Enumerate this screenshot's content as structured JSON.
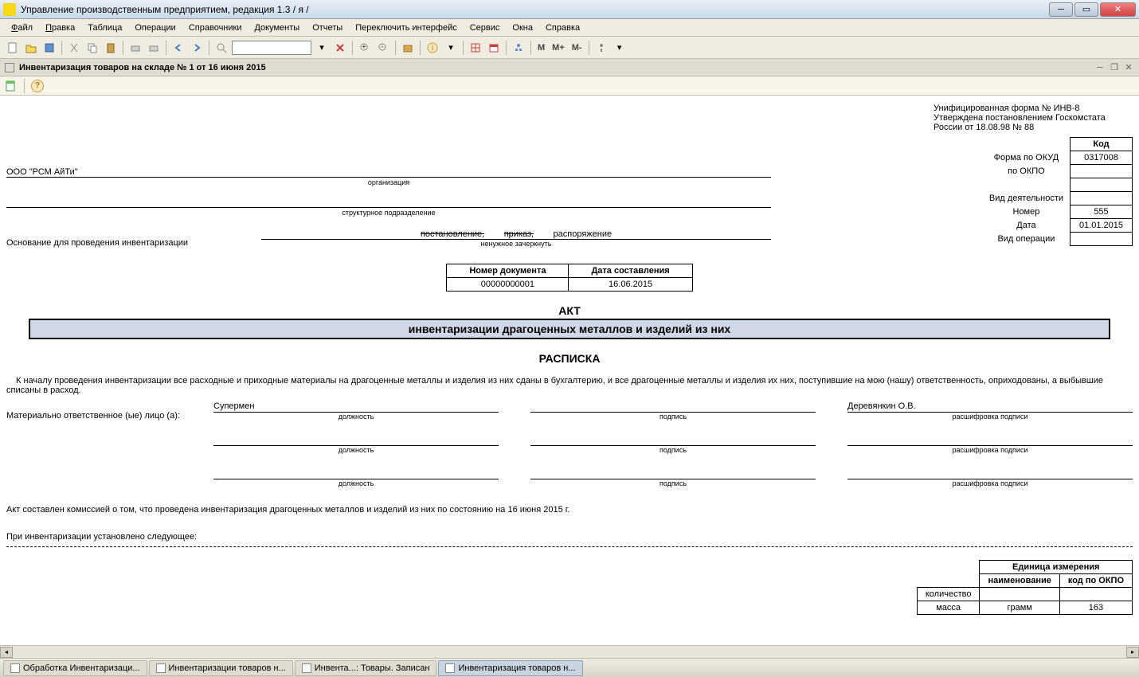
{
  "titlebar": {
    "text": "Управление производственным предприятием, редакция 1.3 / я /"
  },
  "menu": {
    "file": "Файл",
    "edit": "Правка",
    "table": "Таблица",
    "operations": "Операции",
    "directories": "Справочники",
    "documents": "Документы",
    "reports": "Отчеты",
    "switch_interface": "Переключить интерфейс",
    "service": "Сервис",
    "windows": "Окна",
    "help": "Справка"
  },
  "toolbar": {
    "m": "М",
    "mplus": "М+",
    "mminus": "М-"
  },
  "doc_tab": {
    "title": "Инвентаризация товаров на складе № 1 от 16 июня 2015"
  },
  "form": {
    "header_lines": {
      "l1": "Унифицированная форма № ИНВ-8",
      "l2": "Утверждена постановлением Госкомстата",
      "l3": "России от 18.08.98 № 88"
    },
    "code_header": "Код",
    "okud_label": "Форма по ОКУД",
    "okud_val": "0317008",
    "okpo_label": "по ОКПО",
    "activity_label": "Вид деятельности",
    "number_label": "Номер",
    "number_val": "555",
    "date_label": "Дата",
    "date_val": "01.01.2015",
    "operation_label": "Вид операции",
    "org_name": "ООО \"РСМ АйТи\"",
    "org_caption": "организация",
    "subdiv_caption": "структурное подразделение",
    "basis_label": "Основание для проведения инвентаризации",
    "basis_opt1": "постановление,",
    "basis_opt2": "приказ,",
    "basis_opt3": "распоряжение",
    "basis_caption": "ненужное зачеркнуть",
    "docnum_h1": "Номер документа",
    "docnum_h2": "Дата составления",
    "docnum_v1": "00000000001",
    "docnum_v2": "16.06.2015",
    "act_title": "АКТ",
    "act_subtitle": "инвентаризации драгоценных металлов и изделий из них",
    "raspiska": "РАСПИСКА",
    "body": "К началу проведения инвентаризации все расходные и приходные материалы на драгоценные металлы и изделия из них сданы в бухгалтерию, и все драгоценные металлы и изделия их них, поступившие на мою (нашу) ответственность, оприходованы, а выбывшие списаны в расход.",
    "resp_label": "Материально ответственное (ые) лицо (а):",
    "resp_name1": "Супермен",
    "resp_name2": "Деревянкин О.В.",
    "cap_position": "должность",
    "cap_sign": "подпись",
    "cap_decode": "расшифровка подписи",
    "act_composed_prefix": "Акт составлен комиссией о том, что проведена инвентаризация драгоценных металлов и изделий из них  по состоянию на  16 июня 2015 г.",
    "inv_established": "При инвентаризации установлено следующее:",
    "unit_header": "Единица измерения",
    "unit_name_h": "наименование",
    "unit_code_h": "код по ОКПО",
    "qty_label": "количество",
    "mass_label": "масса",
    "mass_name": "грамм",
    "mass_code": "163"
  },
  "taskbar": {
    "b1": "Обработка  Инвентаризаци...",
    "b2": "Инвентаризации товаров н...",
    "b3": "Инвента...: Товары. Записан",
    "b4": "Инвентаризация товаров н..."
  }
}
